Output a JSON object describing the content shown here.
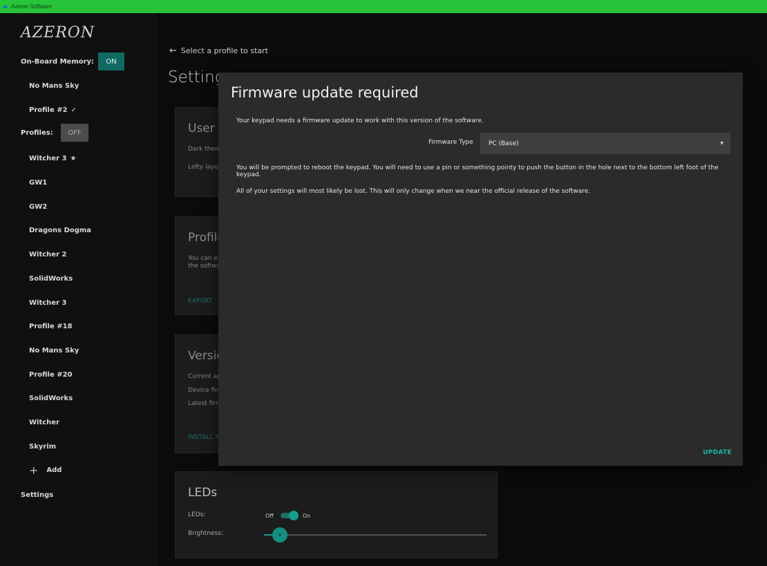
{
  "window": {
    "title": "Azeron Software"
  },
  "sidebar": {
    "logo": "AZERON",
    "onboard_memory": {
      "label": "On-Board Memory:",
      "toggle": "ON"
    },
    "memory_items": [
      {
        "label": "No Mans Sky",
        "mark": ""
      },
      {
        "label": "Profile #2",
        "mark": "✓"
      }
    ],
    "profiles": {
      "label": "Profiles:",
      "toggle": "OFF"
    },
    "profile_items": [
      {
        "label": "Witcher 3",
        "mark": "★"
      },
      {
        "label": "GW1",
        "mark": ""
      },
      {
        "label": "GW2",
        "mark": ""
      },
      {
        "label": "Dragons Dogma",
        "mark": ""
      },
      {
        "label": "Witcher 2",
        "mark": ""
      },
      {
        "label": "SolidWorks",
        "mark": ""
      },
      {
        "label": "Witcher 3",
        "mark": ""
      },
      {
        "label": "Profile #18",
        "mark": ""
      },
      {
        "label": "No Mans Sky",
        "mark": ""
      },
      {
        "label": "Profile #20",
        "mark": ""
      },
      {
        "label": "SolidWorks",
        "mark": ""
      },
      {
        "label": "Witcher",
        "mark": ""
      },
      {
        "label": "Skyrim",
        "mark": ""
      }
    ],
    "add_label": "Add",
    "settings_label": "Settings"
  },
  "main": {
    "back_text": "Select a profile to start",
    "page_title": "Settings",
    "user_interface_card": {
      "title": "User Interface",
      "lines": [
        "Dark theme",
        "Lefty layout"
      ]
    },
    "profiles_card": {
      "title": "Profiles",
      "lines": [
        "You can export",
        "the software"
      ],
      "action": "EXPORT"
    },
    "version_card": {
      "title": "Version",
      "lines": [
        "Current app",
        "Device firmware",
        "Latest firmware"
      ],
      "action": "INSTALL X"
    },
    "leds_card": {
      "title": "LEDs",
      "leds_label": "LEDs:",
      "off_label": "Off",
      "on_label": "On",
      "leds_on": true,
      "brightness_label": "Brightness:",
      "brightness_fraction": 0.07
    }
  },
  "modal": {
    "title": "Firmware update required",
    "message": "Your keypad needs a firmware update to work with this version of the software.",
    "firmware_type_label": "Firmware Type",
    "firmware_type_value": "PC (Base)",
    "paragraph1": "You will be prompted to reboot the keypad. You will need to use a pin or something pointy to push the button in the hole next to the bottom left foot of the keypad.",
    "paragraph2": "All of your settings will most likely be lost. This will only change when we near the official release of the software.",
    "update_label": "UPDATE"
  },
  "colors": {
    "titlebar": "#27c43a",
    "accent_teal": "#169c8c",
    "on_button": "#116a62",
    "off_button": "#4c4c4c",
    "modal_bg": "#2b2b2b"
  }
}
